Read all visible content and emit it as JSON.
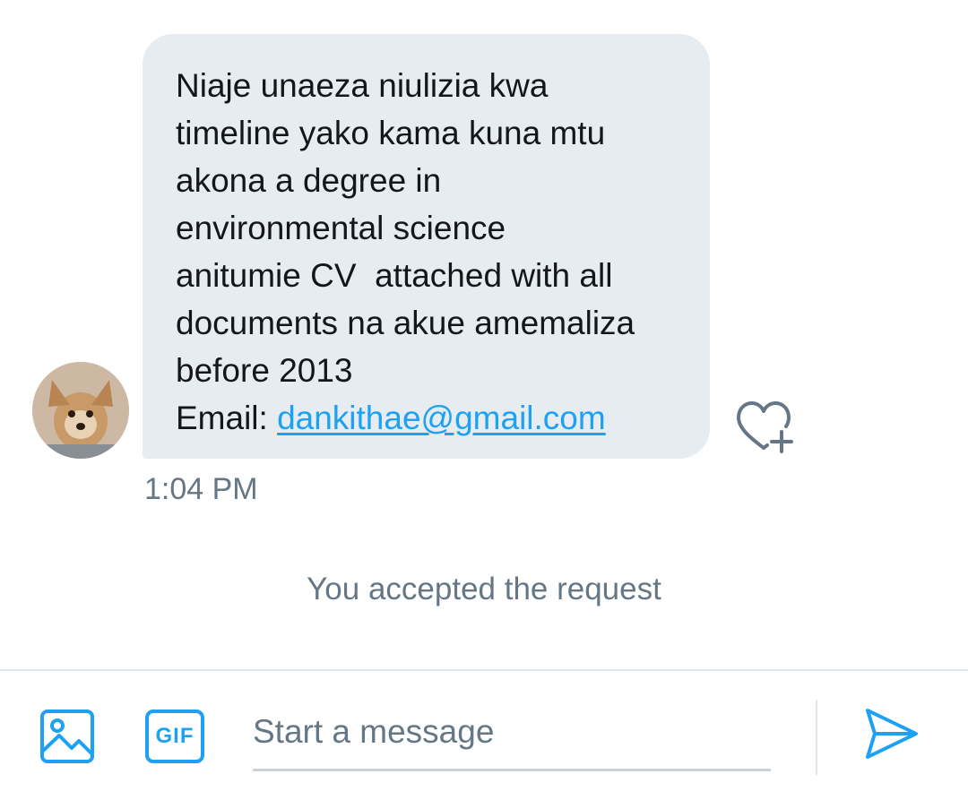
{
  "conversation": {
    "message": {
      "lines": [
        "Niaje unaeza niulizia kwa",
        "timeline yako kama kuna mtu",
        "akona a degree in",
        "environmental science",
        "anitumie CV  attached with all",
        "documents na akue amemaliza",
        "before 2013"
      ],
      "email_label": "Email: ",
      "email_link": "dankithae@gmail.com",
      "timestamp": "1:04 PM"
    },
    "system_note": "You accepted the request"
  },
  "composer": {
    "placeholder": "Start a message",
    "gif_label": "GIF",
    "media_icon": "image-icon",
    "send_icon": "send-icon"
  },
  "colors": {
    "accent": "#1da1f2",
    "bubble": "#e6ecf0",
    "muted_text": "#657786"
  }
}
